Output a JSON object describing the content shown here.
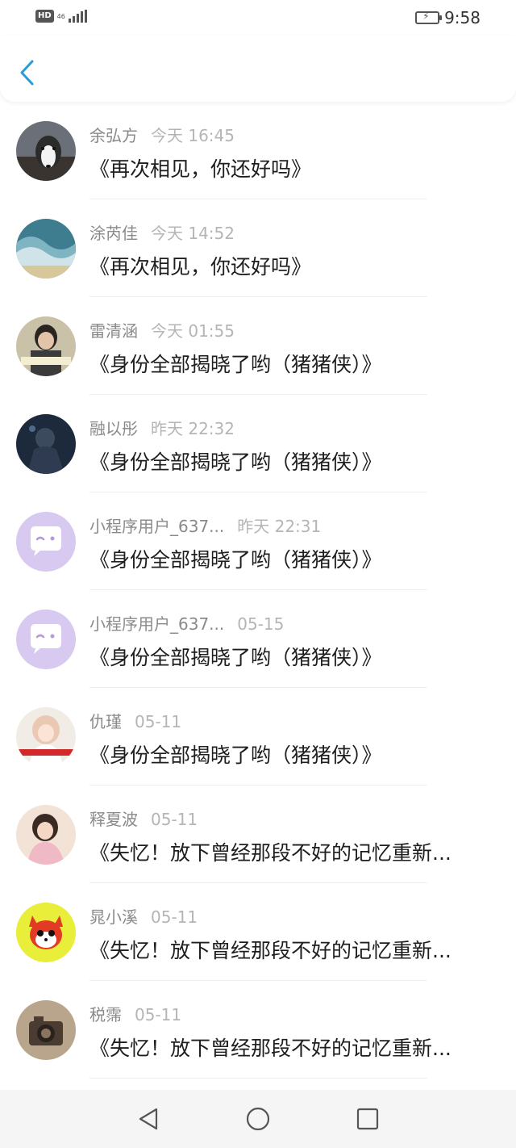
{
  "status_bar": {
    "hd": "HD",
    "network": "46",
    "time": "9:58",
    "battery_icon": "battery-charging-icon",
    "signal_icon": "signal-icon"
  },
  "header": {
    "back_icon": "chevron-left-icon",
    "accent": "#2a9bd8"
  },
  "messages": [
    {
      "name": "余弘方",
      "time": "今天 16:45",
      "title": "《再次相见，你还好吗》",
      "avatar": "husky-photo"
    },
    {
      "name": "涂芮佳",
      "time": "今天 14:52",
      "title": "《再次相见，你还好吗》",
      "avatar": "wave-art"
    },
    {
      "name": "雷清涵",
      "time": "今天 01:55",
      "title": "《身份全部揭晓了哟（猪猪侠）》",
      "avatar": "person-photo"
    },
    {
      "name": "融以彤",
      "time": "昨天 22:32",
      "title": "《身份全部揭晓了哟（猪猪侠）》",
      "avatar": "dark-figure"
    },
    {
      "name": "小程序用户_637...",
      "time": "昨天 22:31",
      "title": "《身份全部揭晓了哟（猪猪侠）》",
      "avatar": "chat-bubble-icon"
    },
    {
      "name": "小程序用户_637...",
      "time": "05-15",
      "title": "《身份全部揭晓了哟（猪猪侠）》",
      "avatar": "chat-bubble-icon"
    },
    {
      "name": "仇瑾",
      "time": "05-11",
      "title": "《身份全部揭晓了哟（猪猪侠）》",
      "avatar": "girl-photo"
    },
    {
      "name": "释夏波",
      "time": "05-11",
      "title": "《失忆！放下曾经那段不好的记忆重新...",
      "avatar": "girl-pink-photo"
    },
    {
      "name": "晁小溪",
      "time": "05-11",
      "title": "《失忆！放下曾经那段不好的记忆重新...",
      "avatar": "fox-cartoon"
    },
    {
      "name": "税霈",
      "time": "05-11",
      "title": "《失忆！放下曾经那段不好的记忆重新...",
      "avatar": "camera-photo"
    }
  ],
  "nav_bar": {
    "back_icon": "triangle-back-icon",
    "home_icon": "circle-home-icon",
    "recents_icon": "square-recents-icon"
  }
}
